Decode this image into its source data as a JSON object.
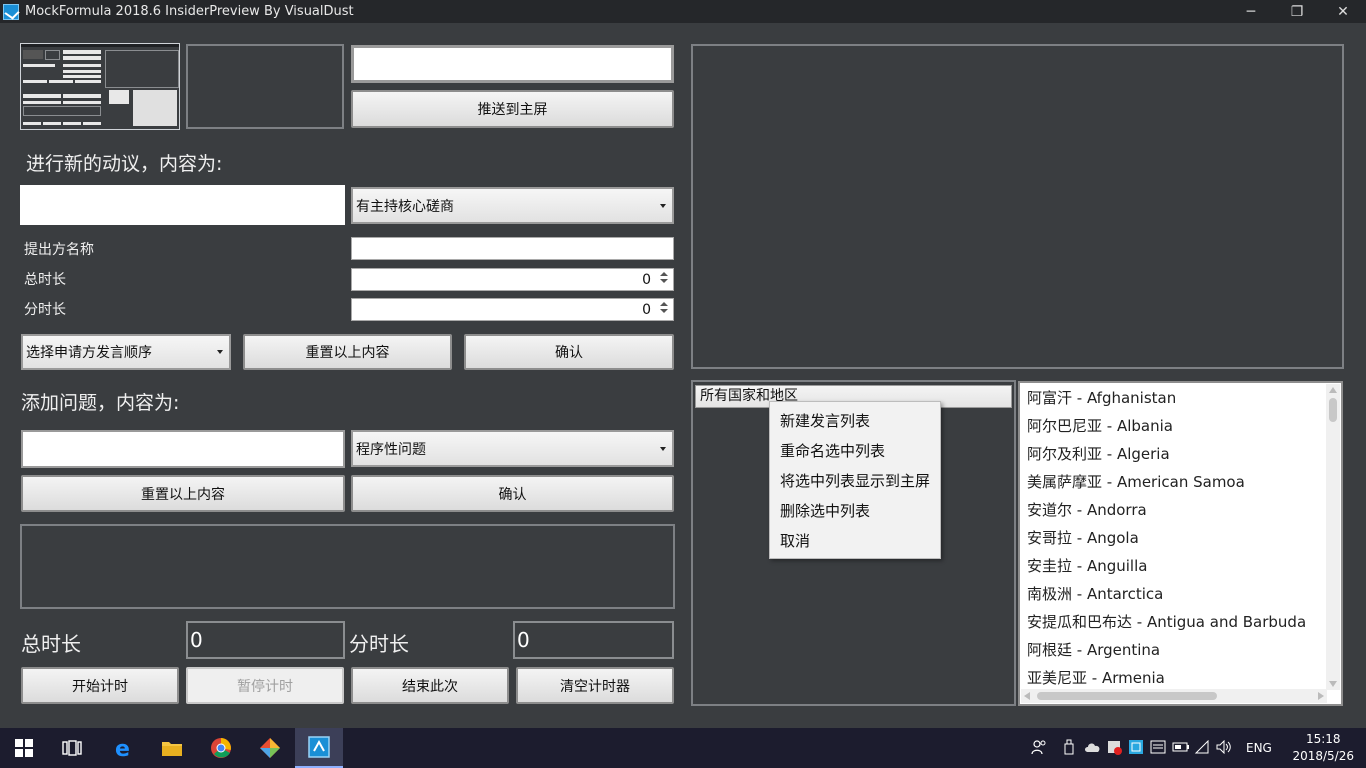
{
  "window": {
    "title": "MockFormula 2018.6 InsiderPreview By VisualDust",
    "minimize": "─",
    "maximize": "❐",
    "close": "✕"
  },
  "top": {
    "push_input_value": "",
    "push_button": "推送到主屏"
  },
  "motion": {
    "heading": "进行新的动议，内容为:",
    "content_value": "",
    "type_selected": "有主持核心磋商",
    "proposer_label": "提出方名称",
    "proposer_value": "",
    "total_time_label": "总时长",
    "total_time_value": "0",
    "each_time_label": "分时长",
    "each_time_value": "0",
    "order_selected": "选择申请方发言顺序",
    "reset_button": "重置以上内容",
    "confirm_button": "确认"
  },
  "question": {
    "heading": "添加问题，内容为:",
    "content_value": "",
    "type_selected": "程序性问题",
    "reset_button": "重置以上内容",
    "confirm_button": "确认"
  },
  "timer": {
    "total_label": "总时长",
    "total_value": "0",
    "each_label": "分时长",
    "each_value": "0",
    "start_button": "开始计时",
    "pause_button": "暂停计时",
    "end_button": "结束此次",
    "clear_button": "清空计时器"
  },
  "speaker_lists": {
    "selected_list": "所有国家和地区"
  },
  "context_menu": {
    "items": [
      "新建发言列表",
      "重命名选中列表",
      "将选中列表显示到主屏",
      "删除选中列表",
      "取消"
    ]
  },
  "countries": [
    "阿富汗 - Afghanistan",
    "阿尔巴尼亚 - Albania",
    "阿尔及利亚 - Algeria",
    "美属萨摩亚 - American Samoa",
    "安道尔 - Andorra",
    "安哥拉 - Angola",
    "安圭拉 - Anguilla",
    "南极洲 - Antarctica",
    "安提瓜和巴布达 - Antigua and Barbuda",
    "阿根廷 - Argentina",
    "亚美尼亚 - Armenia"
  ],
  "taskbar": {
    "language": "ENG",
    "time": "15:18",
    "date": "2018/5/26"
  }
}
